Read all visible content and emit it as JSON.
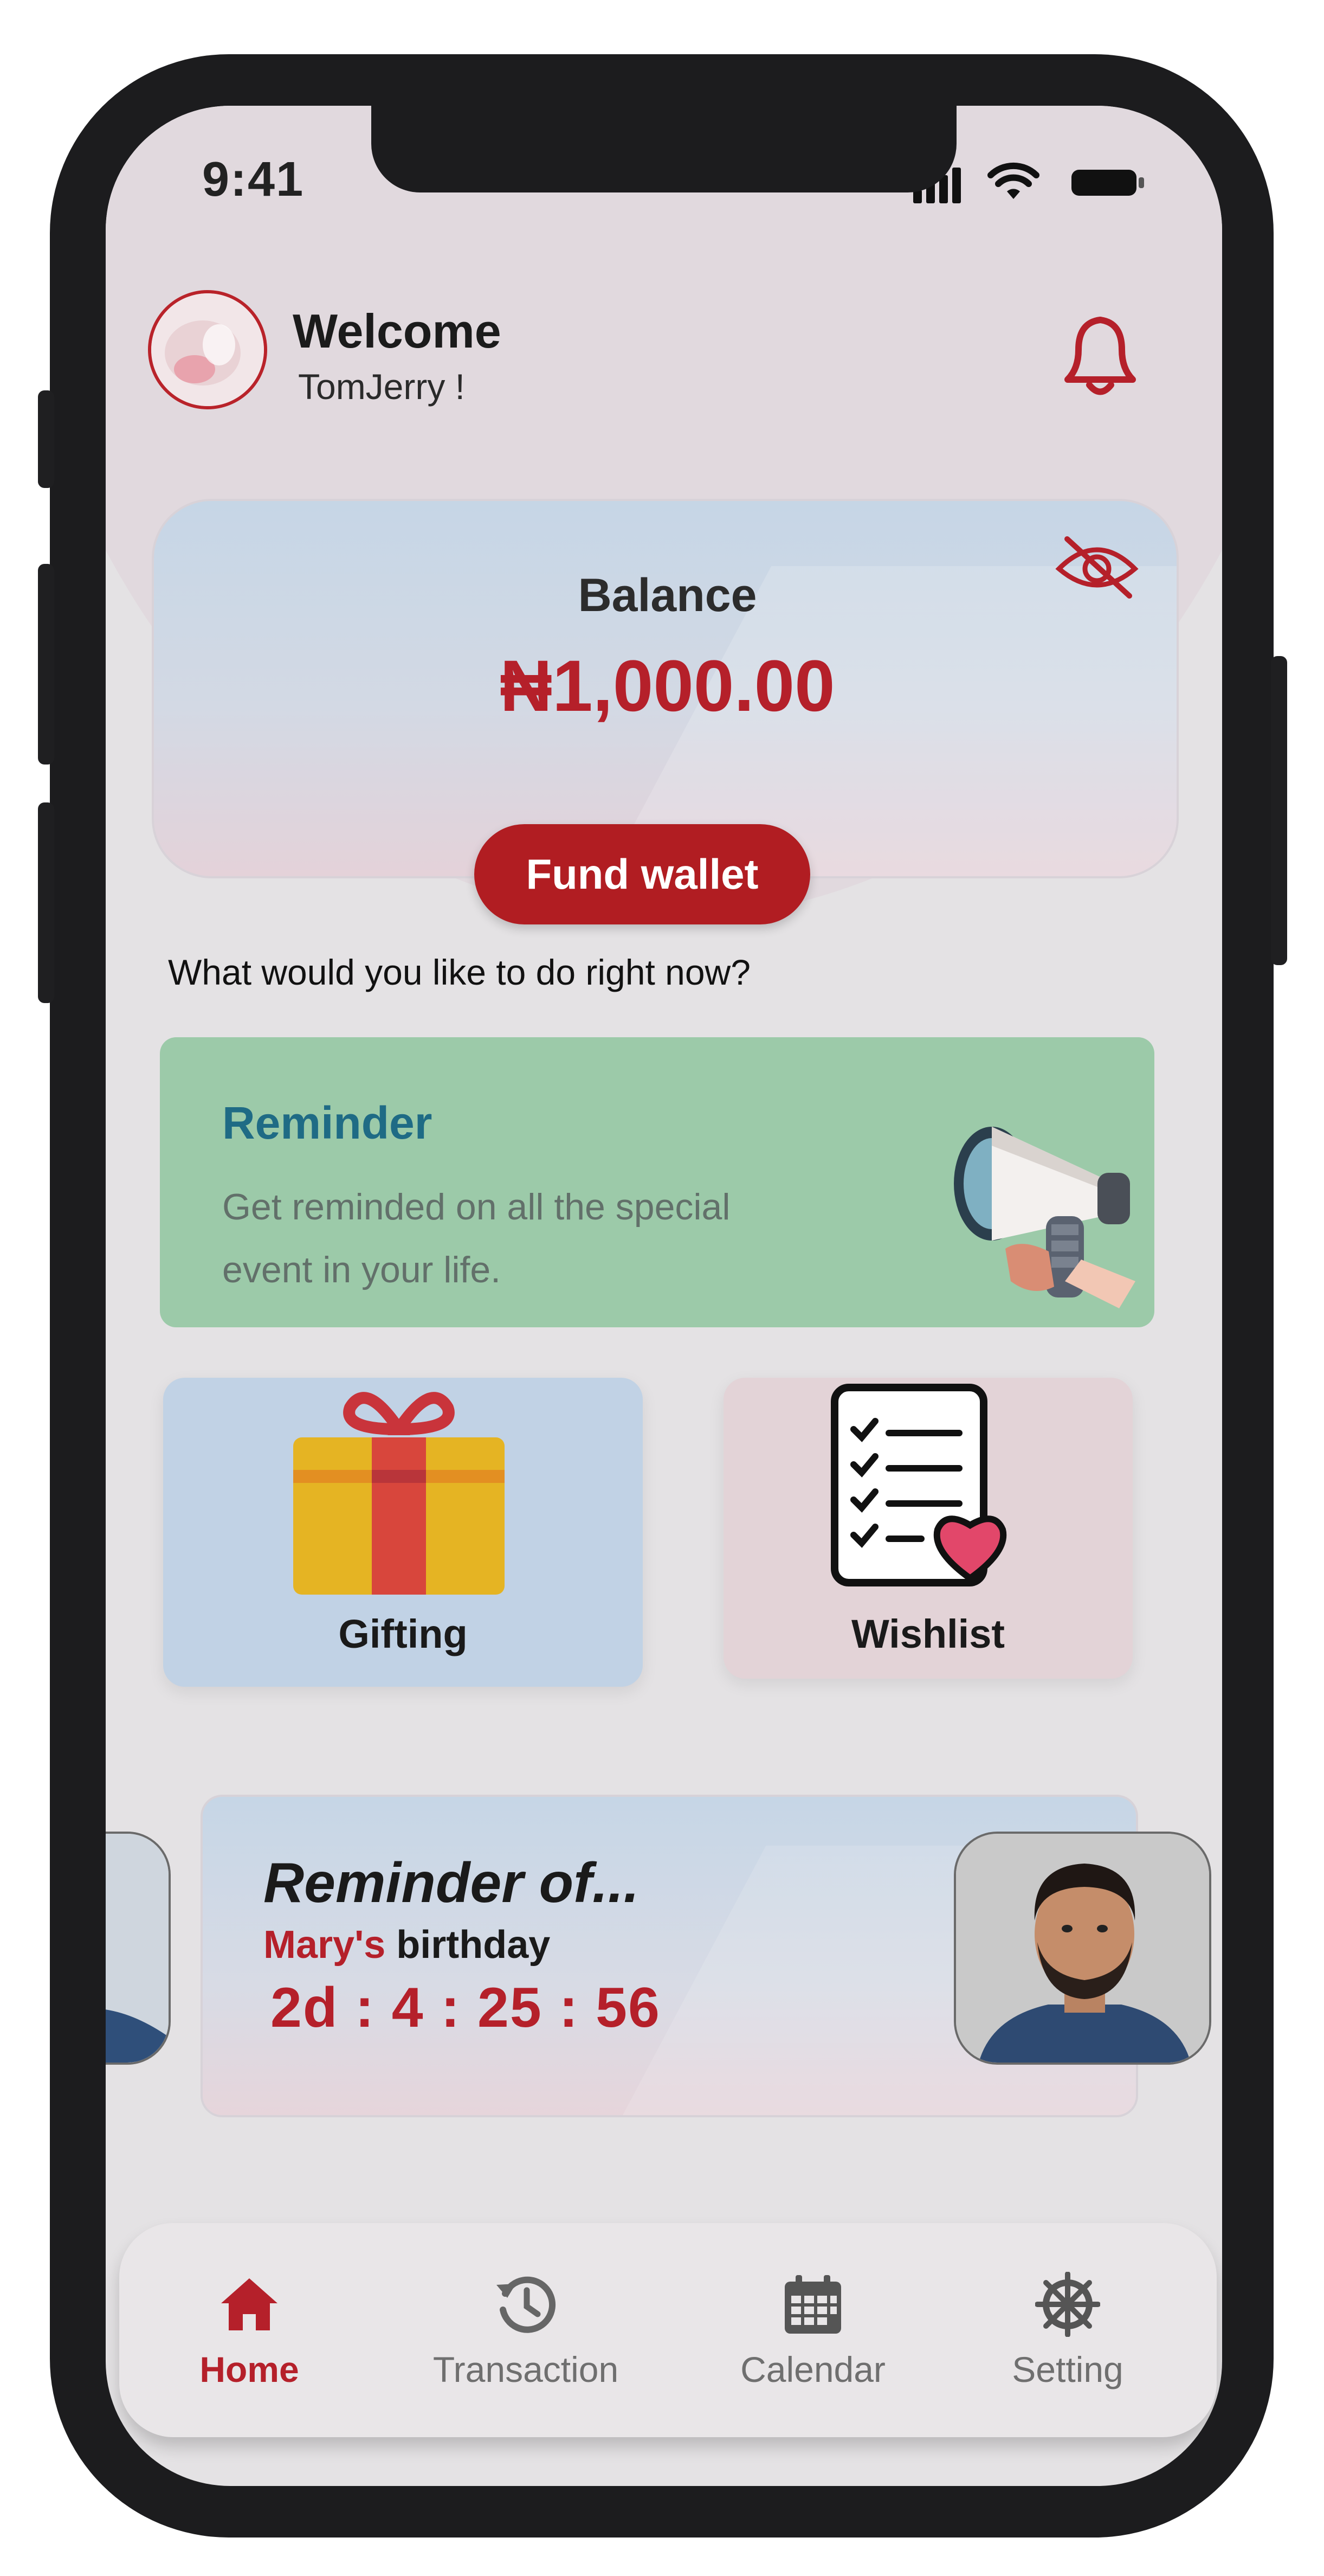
{
  "status_bar": {
    "time": "9:41"
  },
  "header": {
    "welcome": "Welcome",
    "username": "TomJerry !"
  },
  "balance": {
    "label": "Balance",
    "amount": "₦1,000.00",
    "fund_button": "Fund wallet"
  },
  "prompt": "What would you like to do right now?",
  "reminder_card": {
    "title": "Reminder",
    "description": "Get reminded on all the special event in your life."
  },
  "tiles": {
    "gifting": "Gifting",
    "wishlist": "Wishlist"
  },
  "event": {
    "title": "Reminder of...",
    "name": "Mary's",
    "occasion": "birthday",
    "countdown": "2d : 4 : 25 : 56"
  },
  "nav": [
    {
      "label": "Home",
      "icon": "home-icon",
      "active": true
    },
    {
      "label": "Transaction",
      "icon": "history-icon",
      "active": false
    },
    {
      "label": "Calendar",
      "icon": "calendar-icon",
      "active": false
    },
    {
      "label": "Setting",
      "icon": "settings-wheel-icon",
      "active": false
    }
  ],
  "colors": {
    "accent": "#b5202a",
    "reminder_bg": "#9ccaa9",
    "gift_bg": "#c1d2e5",
    "wish_bg": "#e3d3d7"
  }
}
